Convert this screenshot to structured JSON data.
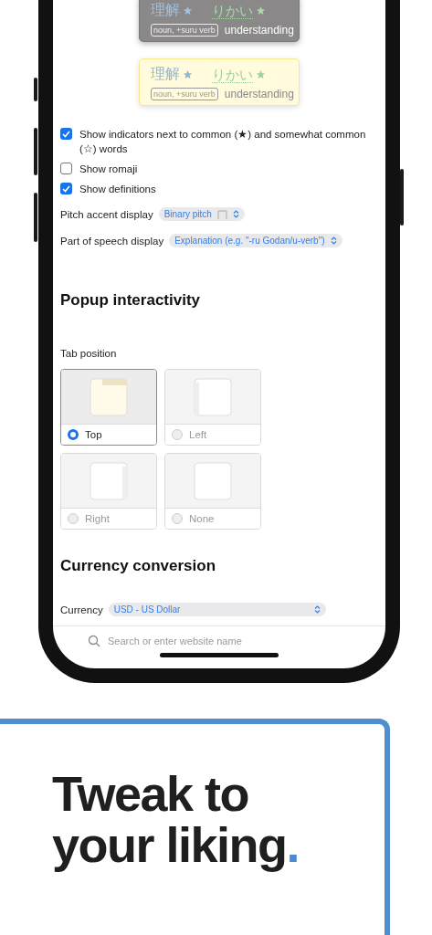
{
  "previews": [
    {
      "kind": "dark",
      "kanji": "理解",
      "reading": "りかい",
      "pos": "noun, +suru verb",
      "gloss": "understanding"
    },
    {
      "kind": "yellow",
      "kanji": "理解",
      "reading": "りかい",
      "pos": "noun, +suru verb",
      "gloss": "understanding"
    }
  ],
  "options": [
    {
      "label": "Show indicators next to common (★) and somewhat common (☆) words",
      "checked": true
    },
    {
      "label": "Show romaji",
      "checked": false
    },
    {
      "label": "Show definitions",
      "checked": true
    }
  ],
  "selects": [
    {
      "kind": "pitch",
      "label": "Pitch accent display",
      "value": "Binary pitch"
    },
    {
      "kind": "plain",
      "label": "Part of speech display",
      "value": "Explanation (e.g. \"-ru Godan/u-verb\")"
    }
  ],
  "popup_interactivity": {
    "heading": "Popup interactivity",
    "tab_position": {
      "label": "Tab position",
      "options": [
        {
          "kind": "top",
          "label": "Top",
          "selected": true
        },
        {
          "kind": "left",
          "label": "Left",
          "selected": false
        },
        {
          "kind": "right",
          "label": "Right",
          "selected": false
        },
        {
          "kind": "none",
          "label": "None",
          "selected": false
        }
      ]
    }
  },
  "currency": {
    "heading": "Currency conversion",
    "label": "Currency",
    "value": "USD - US Dollar"
  },
  "browser_bar": {
    "placeholder": "Search or enter website name"
  },
  "tagline": {
    "line_1": "Tweak to",
    "line_2": "your liking",
    "dot": "."
  }
}
